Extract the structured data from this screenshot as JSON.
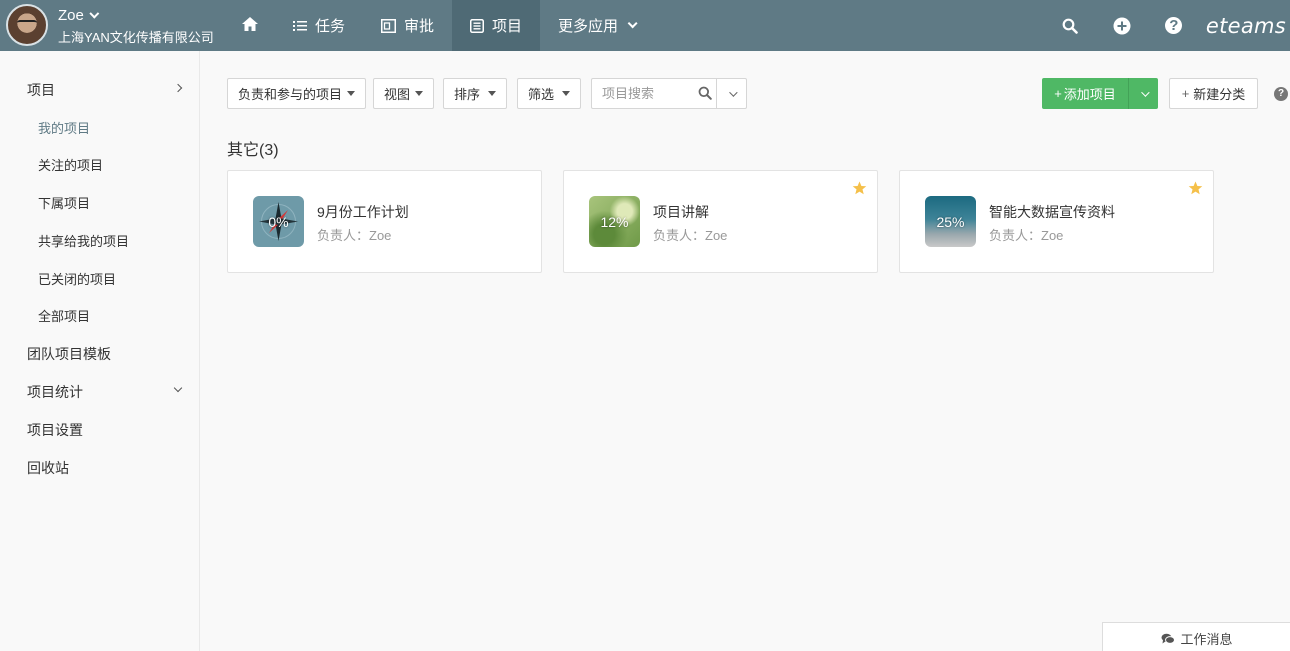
{
  "user": {
    "name": "Zoe",
    "company": "上海YAN文化传播有限公司"
  },
  "nav": {
    "items": [
      {
        "label": "任务",
        "icon": "list-icon"
      },
      {
        "label": "审批",
        "icon": "approval-icon"
      },
      {
        "label": "项目",
        "icon": "project-icon",
        "active": true
      },
      {
        "label": "更多应用",
        "icon": "chevron-down-icon"
      }
    ]
  },
  "topright": {
    "logo": "eteams",
    "icons": [
      "search-icon",
      "plus-circle-icon",
      "help-icon"
    ]
  },
  "sidebar": {
    "items": [
      {
        "label": "项目"
      },
      {
        "label": "我的项目"
      },
      {
        "label": "关注的项目"
      },
      {
        "label": "下属项目"
      },
      {
        "label": "共享给我的项目"
      },
      {
        "label": "已关闭的项目"
      },
      {
        "label": "全部项目"
      },
      {
        "label": "团队项目模板"
      },
      {
        "label": "项目统计"
      },
      {
        "label": "项目设置"
      },
      {
        "label": "回收站"
      }
    ]
  },
  "toolbar": {
    "scope": "负责和参与的项目",
    "view": "视图",
    "sort": "排序",
    "filter": "筛选",
    "search_placeholder": "项目搜索",
    "add": "添加项目",
    "new_category": "新建分类"
  },
  "group": {
    "title": "其它(3)"
  },
  "projects": [
    {
      "title": "9月份工作计划",
      "owner": "负责人：Zoe",
      "progress": "0%",
      "starred": false
    },
    {
      "title": "项目讲解",
      "owner": "负责人：Zoe",
      "progress": "12%",
      "starred": true
    },
    {
      "title": "智能大数据宣传资料",
      "owner": "负责人：Zoe",
      "progress": "25%",
      "starred": true
    }
  ],
  "messages": {
    "label": "工作消息"
  },
  "colors": {
    "topbar": "#5f7a85",
    "active_nav": "#4f6a75",
    "primary_green": "#4fb865",
    "star": "#f5c04a"
  }
}
